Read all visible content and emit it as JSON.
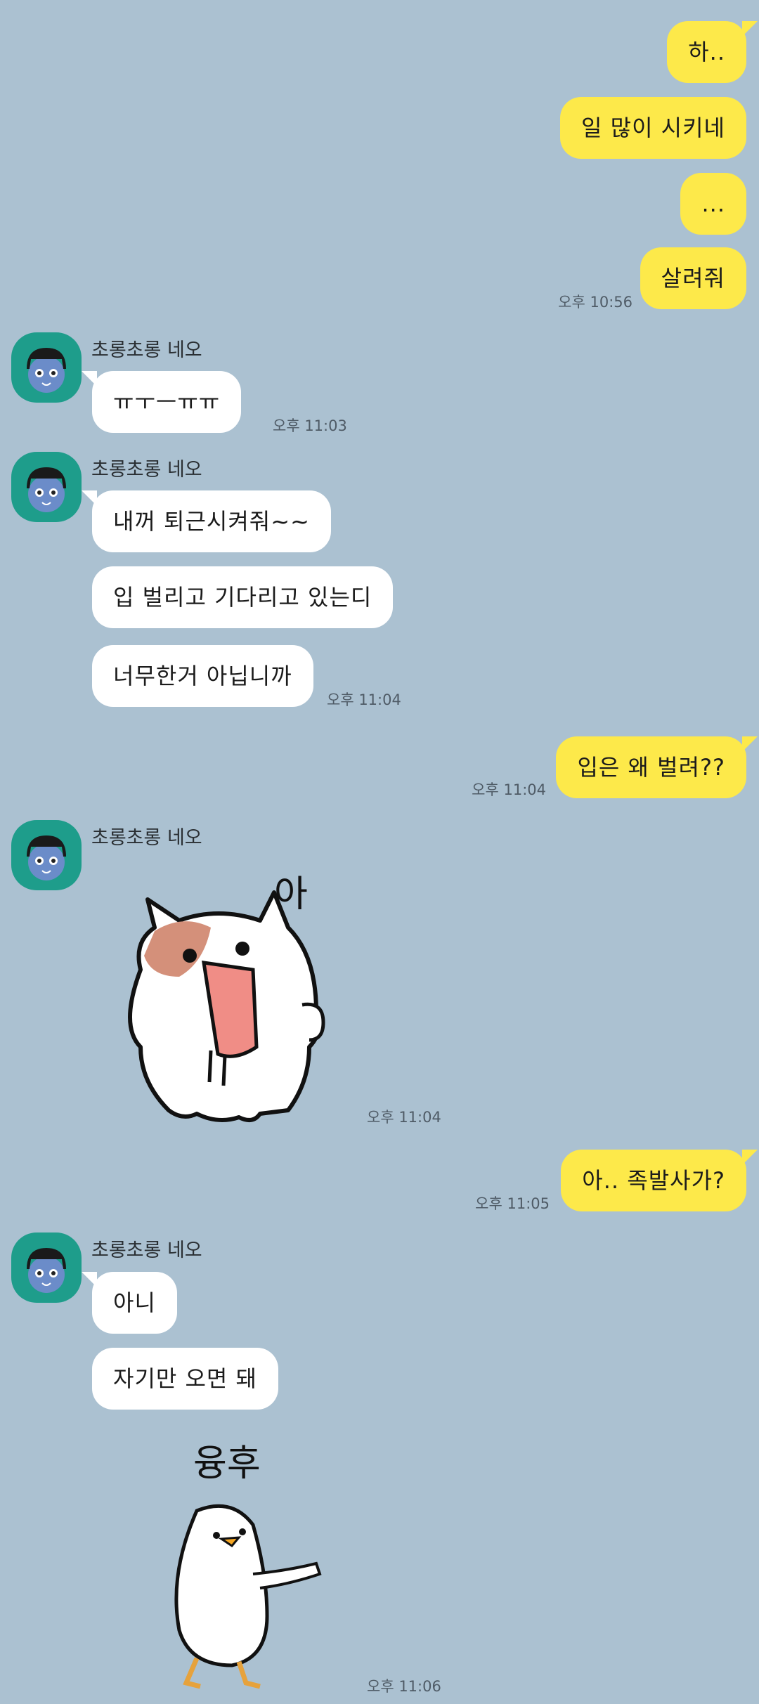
{
  "contact": {
    "name": "초롱초롱 네오"
  },
  "messages": {
    "m1": "하..",
    "m2": "일 많이 시키네",
    "m3": "...",
    "m4": "살려줘",
    "t4": "오후 10:56",
    "r1": "ㅠㅜㅡㅠㅠ",
    "tr1": "오후 11:03",
    "r2": "내꺼 퇴근시켜줘~~",
    "r3": "입 벌리고 기다리고 있는디",
    "r4": "너무한거 아닙니까",
    "tr4": "오후 11:04",
    "m5": "입은 왜 벌려??",
    "t5": "오후 11:04",
    "sticker1_text": "아",
    "tsticker1": "오후 11:04",
    "m6": "아.. 족발사가?",
    "t6": "오후 11:05",
    "r5": "아니",
    "r6": "자기만 오면 돼",
    "sticker2_text": "융후",
    "tsticker2": "오후 11:06"
  },
  "colors": {
    "background": "#abc1d1",
    "my_bubble": "#fde94a",
    "their_bubble": "#ffffff",
    "avatar_bg": "#1e9d8b"
  }
}
